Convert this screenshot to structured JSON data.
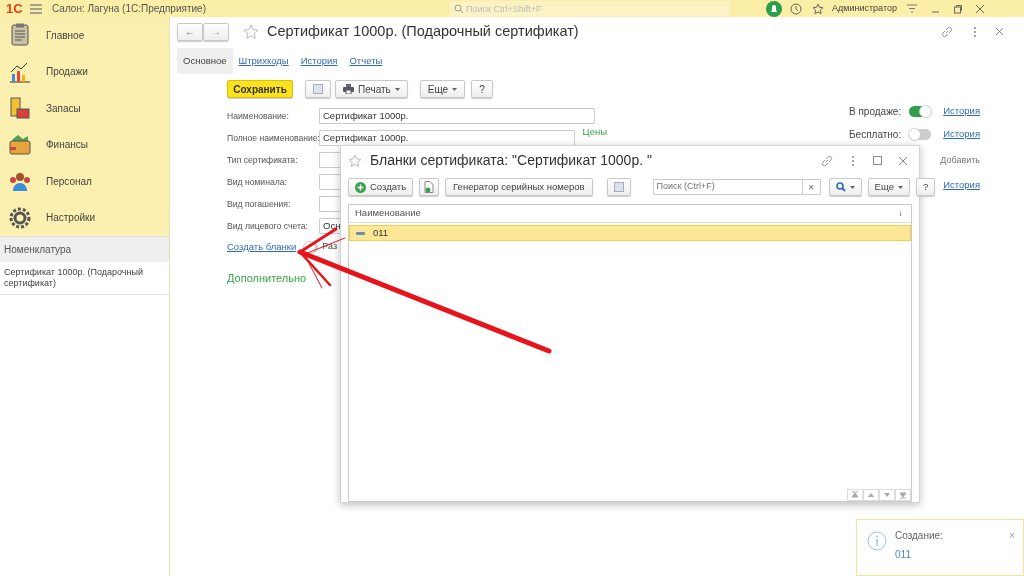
{
  "app": {
    "logo": "1С",
    "title": "Салон: Лагуна  (1С:Предприятие)",
    "search_placeholder": "Поиск Ctrl+Shift+F",
    "user": "Администратор"
  },
  "sections": [
    {
      "kind": "main",
      "label": "Главное",
      "selected": false
    },
    {
      "kind": "sales",
      "label": "Продажи",
      "selected": false
    },
    {
      "kind": "stock",
      "label": "Запасы",
      "selected": false
    },
    {
      "kind": "finance",
      "label": "Финансы",
      "selected": false
    },
    {
      "kind": "staff",
      "label": "Персонал",
      "selected": false
    },
    {
      "kind": "settings",
      "label": "Настройки",
      "selected": false
    }
  ],
  "nav_panel": {
    "title": "Номенклатура",
    "items": [
      {
        "label": "Сертификат 1000р. (Подарочный сертификат)"
      }
    ]
  },
  "form": {
    "title": "Сертификат 1000р. (Подарочный сертификат)",
    "tabs": [
      {
        "label": "Основное",
        "selected": true
      },
      {
        "label": "Штрихкоды",
        "selected": false
      },
      {
        "label": "История",
        "selected": false
      },
      {
        "label": "Отчеты",
        "selected": false
      }
    ],
    "save": "Сохранить",
    "print": "Печать",
    "more": "Еще",
    "help": "?",
    "back": "←",
    "forward": "→",
    "fields": [
      {
        "label": "Наименование:",
        "value": "Сертификат 1000р."
      },
      {
        "label": "Полное наименование:",
        "value": "Сертификат 1000р."
      },
      {
        "label": "Тип сертификата:"
      },
      {
        "label": "Вид номинала:"
      },
      {
        "label": "Вид погашения:"
      },
      {
        "label": "Вид лицевого счета:",
        "value": "Осн"
      }
    ],
    "prices_link": "Цены",
    "create_link": "Создать бланки",
    "split_toggle": {
      "label": "Раз",
      "on": false
    },
    "more_group": "Дополнительно",
    "flags": [
      {
        "label": "В продаже:",
        "on": true,
        "history": "История"
      },
      {
        "label": "Бесплатно:",
        "on": false,
        "history": "История"
      }
    ],
    "add_link": "Добавить",
    "history_link": "История"
  },
  "dialog": {
    "title": "Бланки сертификата: \"Сертификат 1000р. \"",
    "create": "Создать",
    "generator": "Генератор серийных номеров",
    "search_placeholder": "Поиск (Ctrl+F)",
    "clear": "×",
    "more": "Еще",
    "help": "?",
    "column": "Наименование",
    "sort_mark": "↓",
    "rows": [
      {
        "name": "011",
        "selected": true
      }
    ]
  },
  "notification": {
    "title": "Создание:",
    "link": "011",
    "close": "×"
  }
}
